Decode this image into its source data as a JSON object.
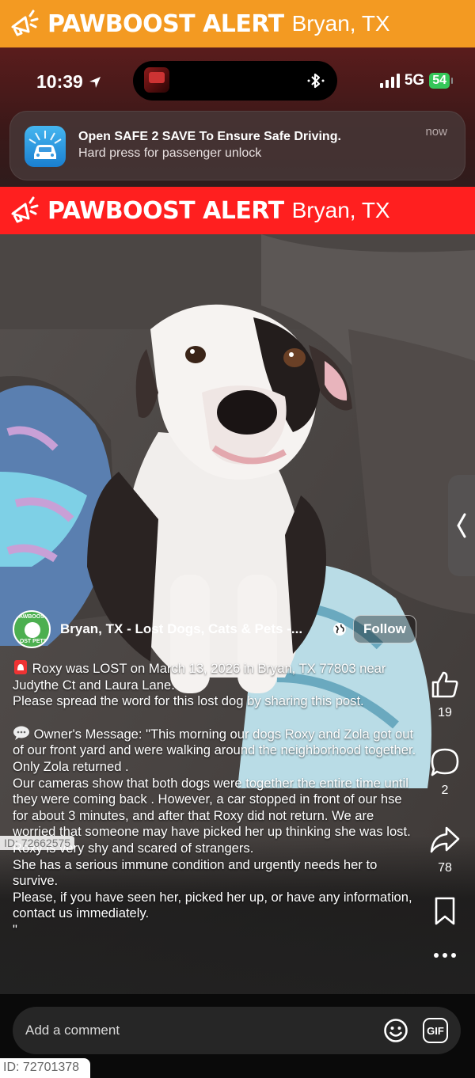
{
  "top_banner": {
    "title": "PAWBOOST ALERT",
    "location": "Bryan, TX",
    "icon": "megaphone-icon",
    "color": "#f39a22"
  },
  "status_bar": {
    "time": "10:39",
    "network": "5G",
    "battery": "54"
  },
  "notification": {
    "title": "Open SAFE 2 SAVE To Ensure Safe Driving.",
    "subtitle": "Hard press for passenger unlock",
    "time": "now",
    "icon": "car-icon"
  },
  "alert_banner": {
    "title": "PAWBOOST ALERT",
    "location": "Bryan, TX",
    "icon": "megaphone-icon",
    "color": "#ff1f1f"
  },
  "group": {
    "avatar_top": "PAWBOOST",
    "avatar_bottom": "LOST PETS",
    "name": "Bryan, TX - Lost Dogs, Cats & Pets -...",
    "follow_label": "Follow"
  },
  "post": {
    "intro": "Roxy was LOST on March 13, 2026 in Bryan, TX 77803 near Judythe Ct and Laura Lane.\nPlease spread the word for this lost dog by sharing this post.",
    "message": "Owner's Message: \"This morning our dogs Roxy and Zola got out of our front yard and were walking around the neighborhood together. Only Zola returned .\nOur cameras show that both dogs were together the entire time until they were coming back . However, a car stopped in front of our hse for about 3 minutes, and after that Roxy did not return. We are worried that someone may have picked her up thinking she was lost.\nRoxy is very shy and scared of strangers.\nShe has a serious immune condition and urgently needs her to survive.\nPlease, if you have seen her, picked her up, or have any information, contact us immediately.\n\""
  },
  "actions": {
    "likes": "19",
    "comments": "2",
    "shares": "78"
  },
  "watermark_mid": "ID: 72662575",
  "comment_bar": {
    "placeholder": "Add a comment",
    "gif_label": "GIF"
  },
  "watermark_bottom": "ID: 72701378"
}
